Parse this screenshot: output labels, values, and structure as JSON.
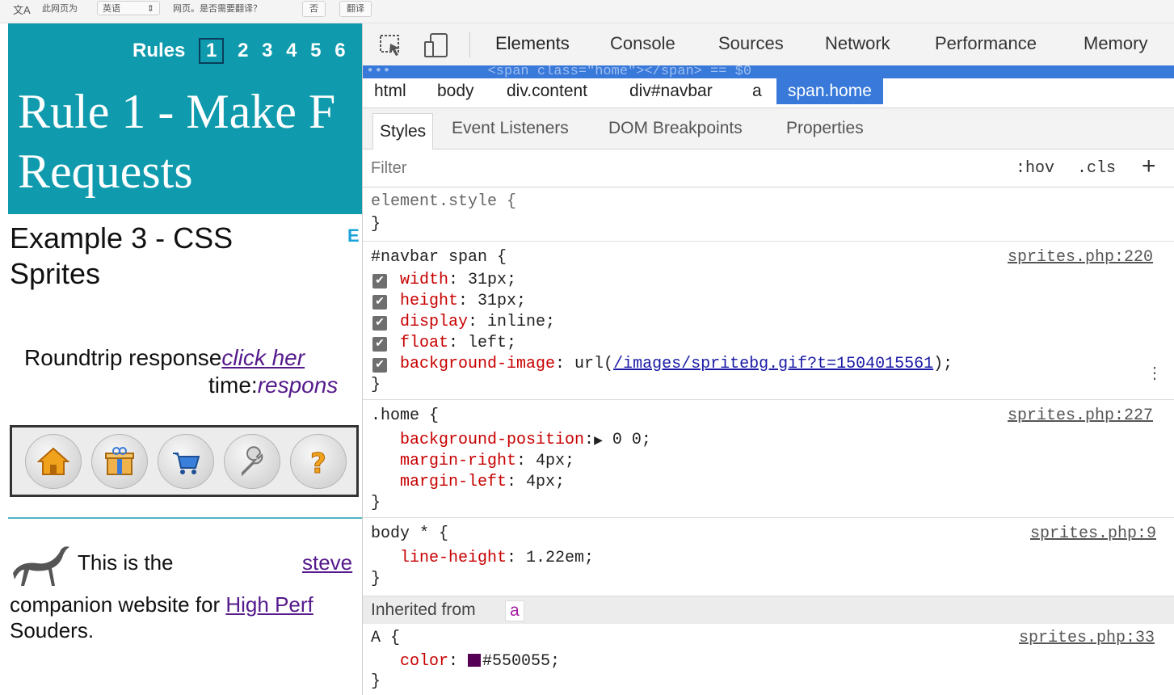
{
  "translate_bar": {
    "logo": "文A",
    "prefix": "此网页为",
    "language": "英语",
    "question": "网页。是否需要翻译？",
    "no_label": "否",
    "translate_label": "翻译"
  },
  "page": {
    "rules_label": "Rules",
    "rule_numbers": [
      "1",
      "2",
      "3",
      "4",
      "5",
      "6"
    ],
    "title_line1": "Rule 1 - Make F",
    "title_line2": "Requests",
    "example_line1": "Example 3 - CSS",
    "example_line2": "Sprites",
    "example_side": "E",
    "roundtrip_text": "Roundtrip response",
    "roundtrip_link": "click her",
    "time_label": "time:",
    "time_value": "respons",
    "bio_text": "This is the",
    "bio_link": "steve",
    "companion_text": "companion website for ",
    "companion_link": "High Perf",
    "author_tail": "Souders."
  },
  "devtools": {
    "tabs": [
      "Elements",
      "Console",
      "Sources",
      "Network",
      "Performance",
      "Memory"
    ],
    "selected_node": "<span class=\"home\"></span> == $0",
    "breadcrumbs": [
      "html",
      "body",
      "div.content",
      "div#navbar",
      "a",
      "span.home"
    ],
    "subtabs": [
      "Styles",
      "Event Listeners",
      "DOM Breakpoints",
      "Properties"
    ],
    "filter_placeholder": "Filter",
    "hov": ":hov",
    "cls": ".cls",
    "plus": "+",
    "element_style": "element.style {",
    "close_brace": "}",
    "navbar_selector": "#navbar span {",
    "navbar_source": "sprites.php:220",
    "navbar_props": [
      {
        "name": "width",
        "value": "31px;"
      },
      {
        "name": "height",
        "value": "31px;"
      },
      {
        "name": "display",
        "value": "inline;"
      },
      {
        "name": "float",
        "value": "left;"
      },
      {
        "name": "background-image",
        "value_prefix": "url(",
        "value_link": "/images/spritebg.gif?t=1504015561",
        "value_suffix": ");"
      }
    ],
    "home_selector": ".home {",
    "home_source": "sprites.php:227",
    "home_props": [
      {
        "name": "background-position",
        "value": "0 0;"
      },
      {
        "name": "margin-right",
        "value": "4px;"
      },
      {
        "name": "margin-left",
        "value": "4px;"
      }
    ],
    "body_selector": "body * {",
    "body_source": "sprites.php:9",
    "body_prop": {
      "name": "line-height",
      "value": "1.22em;"
    },
    "inherited_label": "Inherited from",
    "inherited_tag": "a",
    "a_selector": "A {",
    "a_source": "sprites.php:33",
    "a_prop": {
      "name": "color",
      "value": "#550055;"
    },
    "swatch_color": "#550055"
  }
}
